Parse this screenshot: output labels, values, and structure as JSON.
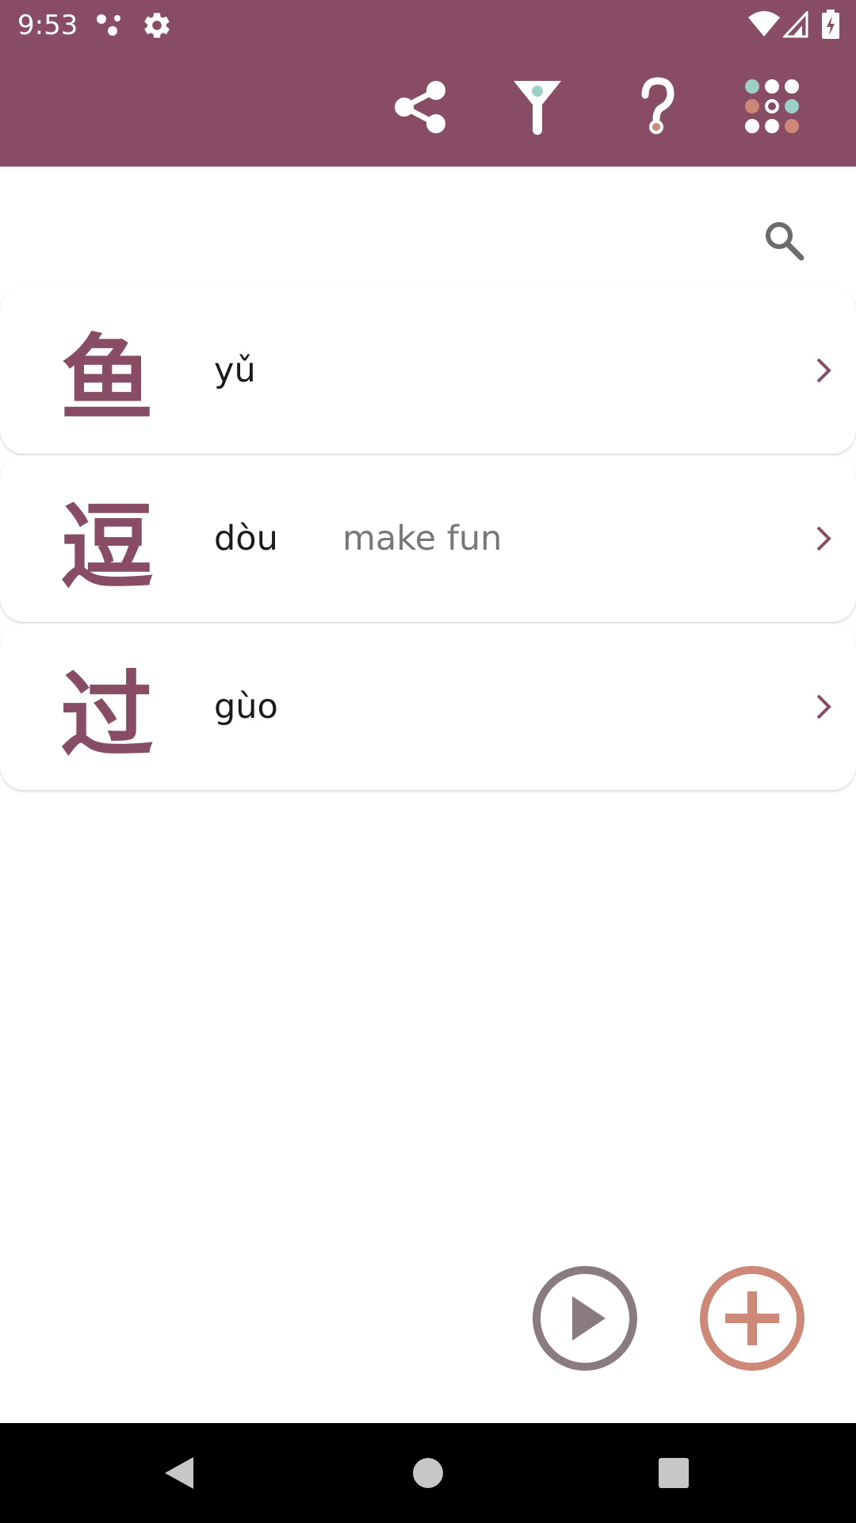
{
  "status_bar": {
    "time": "9:53",
    "icons": [
      "dots-icon",
      "settings-icon",
      "wifi-icon",
      "signal-icon",
      "battery-charging-icon"
    ]
  },
  "toolbar": {
    "background": "#884d64",
    "actions": [
      "share-icon",
      "filter-icon",
      "help-icon",
      "apps-grid-icon"
    ]
  },
  "search": {
    "icon": "search-icon"
  },
  "entries": [
    {
      "character": "鱼",
      "pinyin": "yǔ",
      "meaning": ""
    },
    {
      "character": "逗",
      "pinyin": "dòu",
      "meaning": "make fun"
    },
    {
      "character": "过",
      "pinyin": "gùo",
      "meaning": ""
    }
  ],
  "fabs": {
    "play_icon": "play-circle-icon",
    "add_icon": "add-circle-icon",
    "play_color": "#8a7b80",
    "add_color": "#cd8878"
  },
  "nav_bar": {
    "icons": [
      "back-icon",
      "home-icon",
      "recents-icon"
    ]
  },
  "colors": {
    "accent": "#884d64",
    "teal_dot": "#9ccfc6",
    "salmon_dot": "#cd8878"
  }
}
